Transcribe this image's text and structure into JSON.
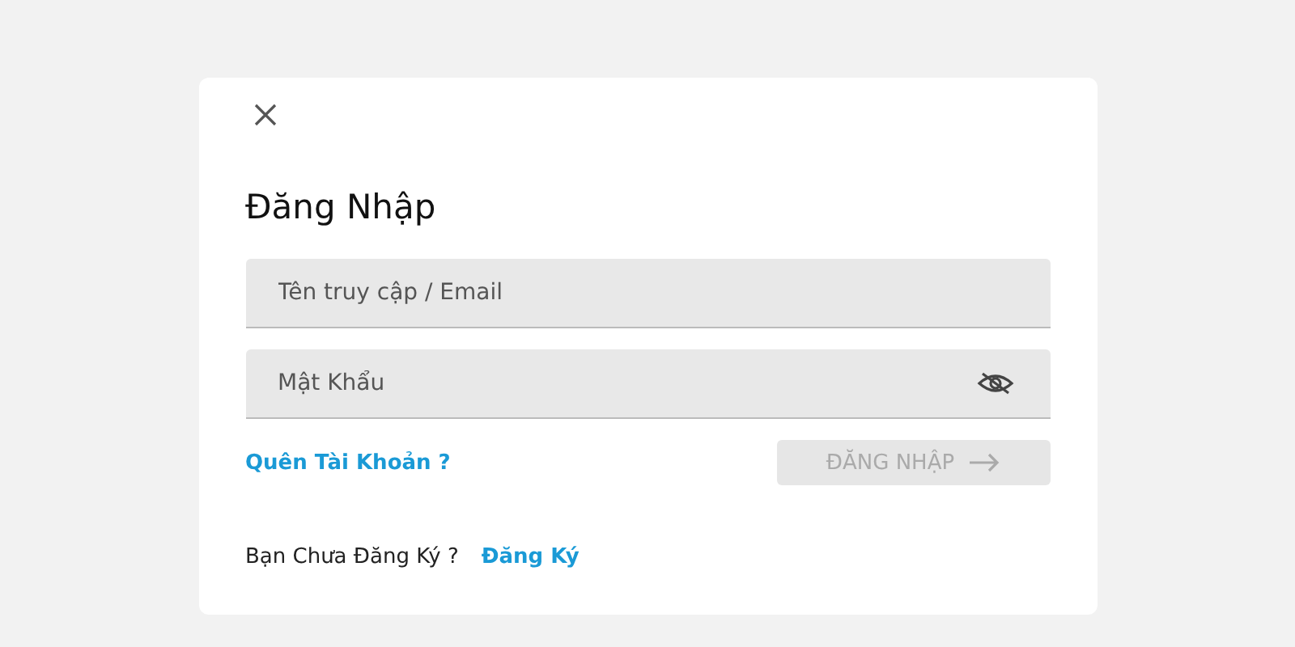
{
  "dialog": {
    "title": "Đăng Nhập",
    "fields": [
      {
        "kind": "text",
        "placeholder": "Tên truy cập / Email"
      },
      {
        "kind": "password",
        "placeholder": "Mật Khẩu"
      }
    ],
    "forgot_link": "Quên Tài Khoản ?",
    "login_button": {
      "label": "ĐĂNG NHẬP",
      "disabled": true
    },
    "signup_prompt": "Bạn Chưa Đăng Ký ?",
    "signup_link": "Đăng Ký"
  }
}
